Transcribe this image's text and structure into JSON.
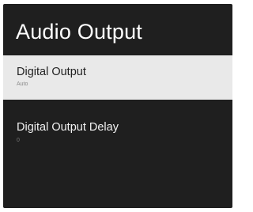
{
  "page": {
    "title": "Audio Output"
  },
  "menu": {
    "items": [
      {
        "label": "Digital Output",
        "value": "Auto"
      },
      {
        "label": "Digital Output Delay",
        "value": "0"
      }
    ]
  }
}
